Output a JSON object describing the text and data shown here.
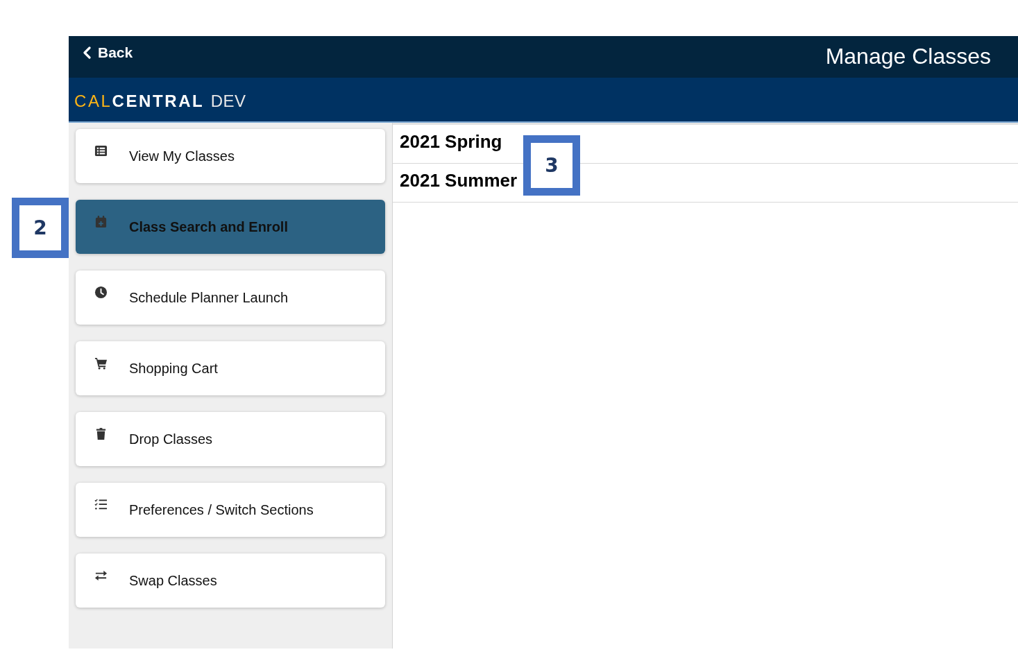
{
  "top_bar": {
    "back_label": "Back",
    "title": "Manage Classes"
  },
  "brand": {
    "accent": "CAL",
    "main": "CENTRAL",
    "suffix": "DEV"
  },
  "menu": [
    {
      "label": "View My Classes",
      "selected": false
    },
    {
      "label": "Class Search and Enroll",
      "selected": true,
      "callout": "2"
    },
    {
      "label": "Schedule Planner Launch",
      "selected": false
    },
    {
      "label": "Shopping Cart",
      "selected": false
    },
    {
      "label": "Drop Classes",
      "selected": false
    },
    {
      "label": "Preferences / Switch Sections",
      "selected": false
    },
    {
      "label": "Swap Classes",
      "selected": false
    }
  ],
  "terms": {
    "callout": "3",
    "items": [
      {
        "label": "2021 Spring"
      },
      {
        "label": "2021 Summer"
      }
    ]
  }
}
